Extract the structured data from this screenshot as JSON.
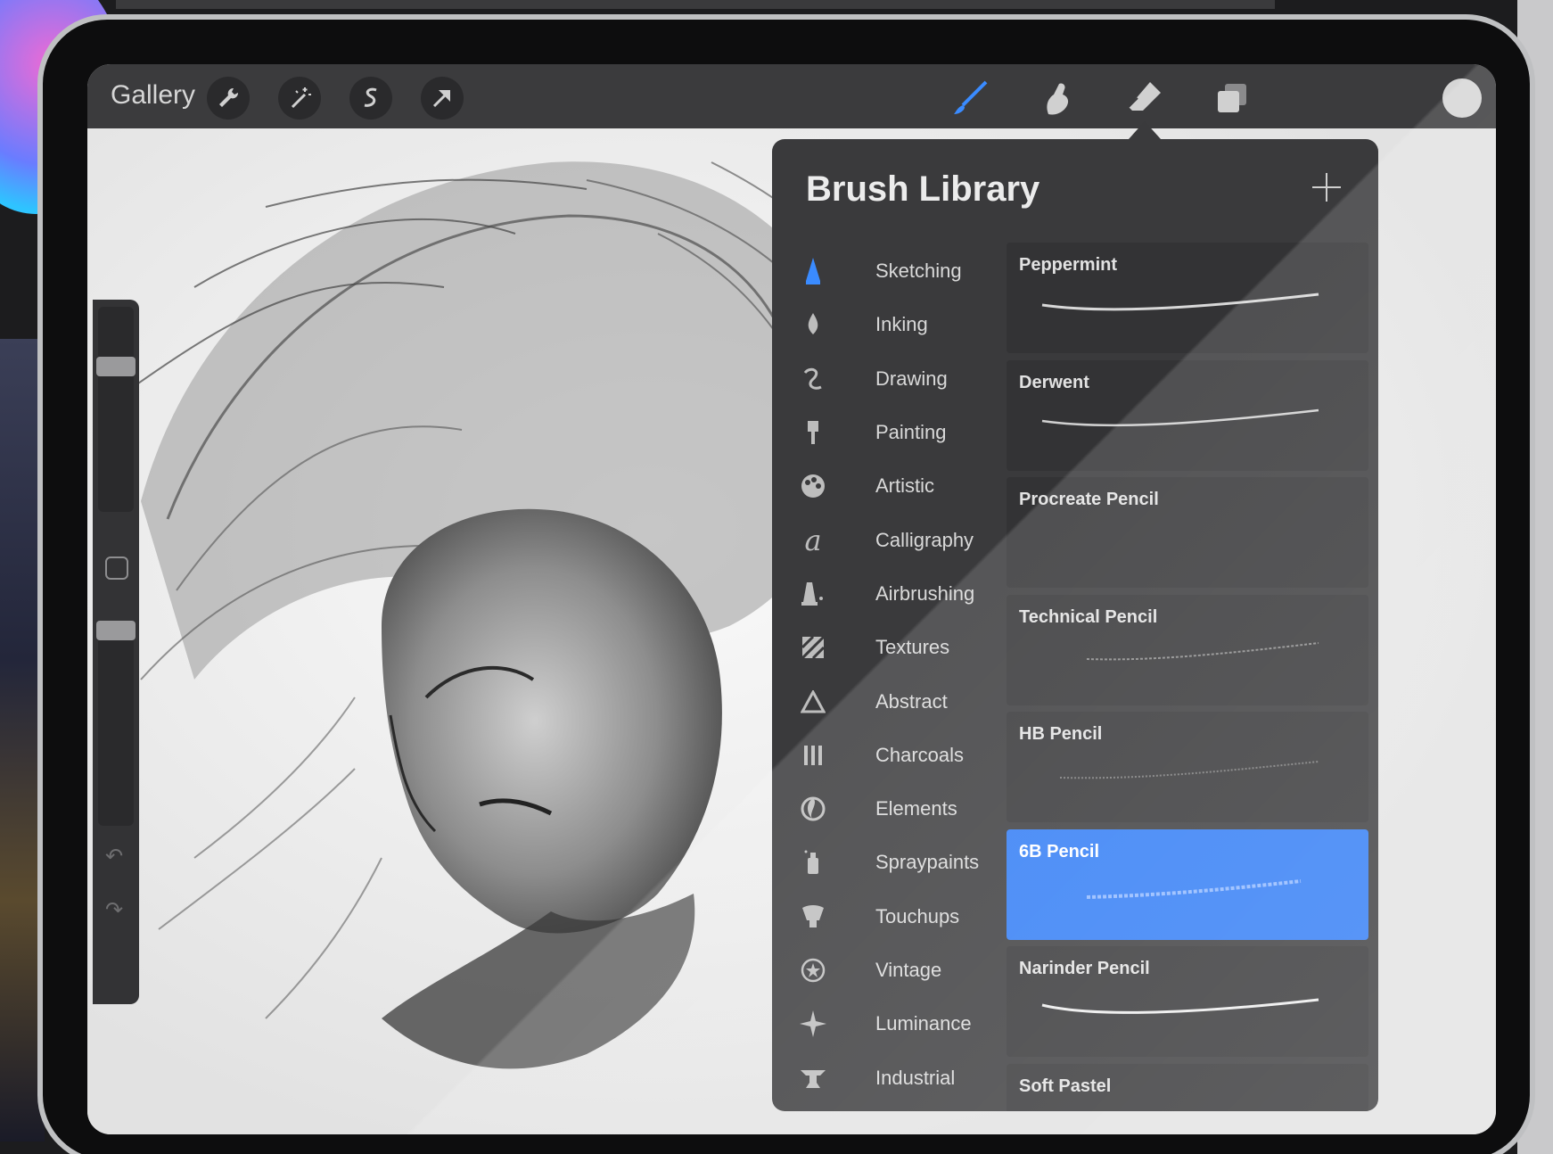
{
  "toolbar": {
    "gallery_label": "Gallery",
    "left_tools": [
      "wrench-icon",
      "magic-wand-icon",
      "selection-icon",
      "transform-arrow-icon"
    ],
    "right_tools": [
      "brush-icon",
      "smudge-icon",
      "eraser-icon",
      "layers-icon"
    ],
    "active_tool": "brush-icon",
    "current_color": "#d6d6d6"
  },
  "brush_library": {
    "title": "Brush Library",
    "categories": [
      {
        "label": "Sketching",
        "icon": "sketching-icon",
        "selected": true
      },
      {
        "label": "Inking",
        "icon": "inking-icon"
      },
      {
        "label": "Drawing",
        "icon": "drawing-icon"
      },
      {
        "label": "Painting",
        "icon": "painting-icon"
      },
      {
        "label": "Artistic",
        "icon": "palette-icon"
      },
      {
        "label": "Calligraphy",
        "icon": "calligraphy-icon"
      },
      {
        "label": "Airbrushing",
        "icon": "airbrush-icon"
      },
      {
        "label": "Textures",
        "icon": "textures-icon"
      },
      {
        "label": "Abstract",
        "icon": "abstract-icon"
      },
      {
        "label": "Charcoals",
        "icon": "charcoal-icon"
      },
      {
        "label": "Elements",
        "icon": "elements-icon"
      },
      {
        "label": "Spraypaints",
        "icon": "spraypaint-icon"
      },
      {
        "label": "Touchups",
        "icon": "touchups-icon"
      },
      {
        "label": "Vintage",
        "icon": "vintage-icon"
      },
      {
        "label": "Luminance",
        "icon": "luminance-icon"
      },
      {
        "label": "Industrial",
        "icon": "industrial-icon"
      }
    ],
    "brushes": [
      {
        "name": "Peppermint",
        "stroke": "smooth"
      },
      {
        "name": "Derwent",
        "stroke": "smooth"
      },
      {
        "name": "Procreate Pencil",
        "stroke": "none"
      },
      {
        "name": "Technical Pencil",
        "stroke": "faint"
      },
      {
        "name": "HB Pencil",
        "stroke": "faint"
      },
      {
        "name": "6B Pencil",
        "stroke": "grainy",
        "selected": true
      },
      {
        "name": "Narinder Pencil",
        "stroke": "bold"
      },
      {
        "name": "Soft Pastel",
        "stroke": "none"
      }
    ],
    "accent": "#2f7bf5",
    "active_category_color": "#3a8bff"
  }
}
